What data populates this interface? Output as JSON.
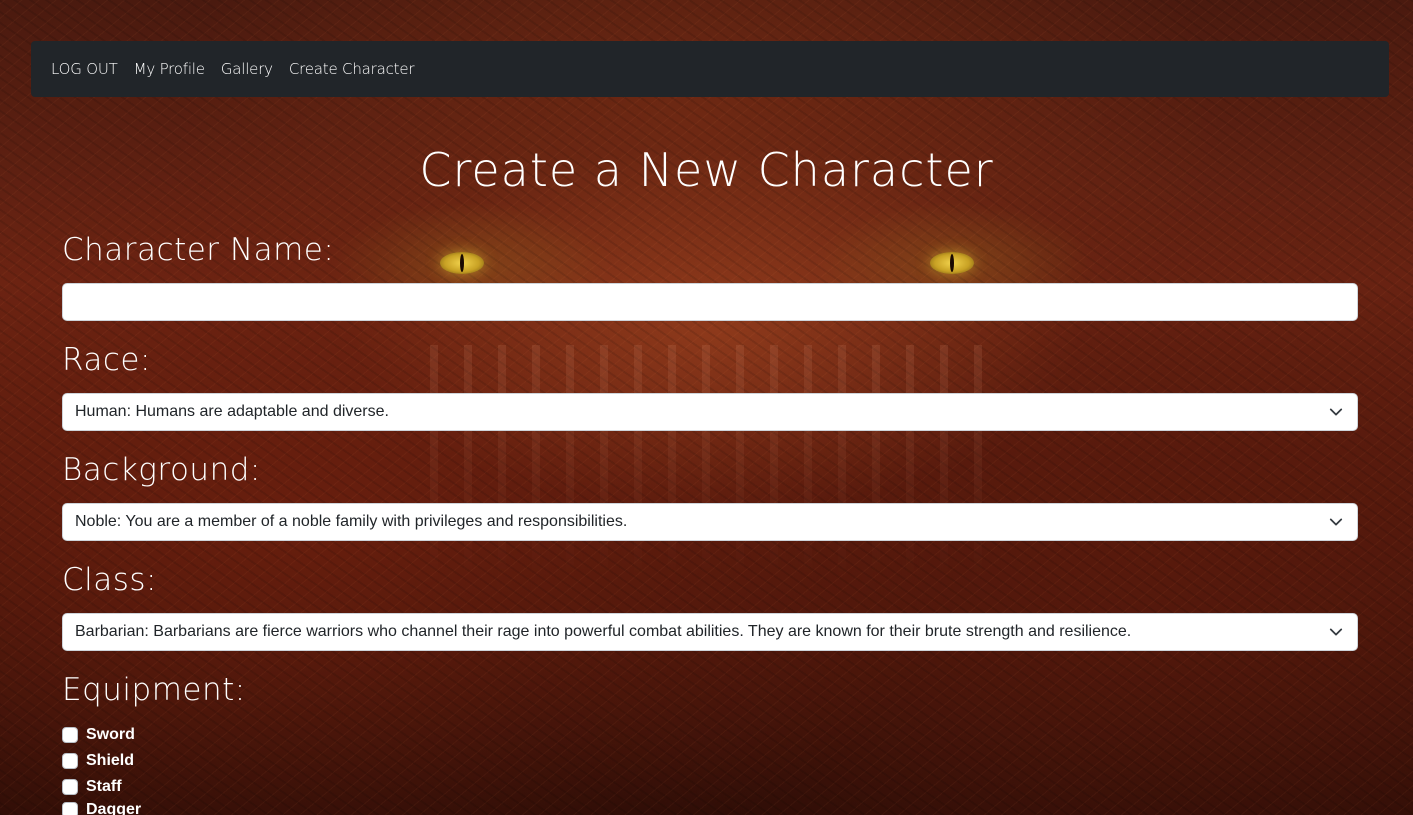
{
  "nav": {
    "logout": "LOG OUT",
    "profile": "My Profile",
    "gallery": "Gallery",
    "create": "Create Character"
  },
  "page": {
    "title": "Create a New Character"
  },
  "form": {
    "name_label": "Character Name:",
    "name_value": "",
    "race_label": "Race:",
    "race_value": "Human: Humans are adaptable and diverse.",
    "background_label": "Background:",
    "background_value": "Noble: You are a member of a noble family with privileges and responsibilities.",
    "class_label": "Class:",
    "class_value": "Barbarian: Barbarians are fierce warriors who channel their rage into powerful combat abilities. They are known for their brute strength and resilience.",
    "equipment_label": "Equipment:",
    "equipment": [
      {
        "label": "Sword",
        "checked": false
      },
      {
        "label": "Shield",
        "checked": false
      },
      {
        "label": "Staff",
        "checked": false
      },
      {
        "label": "Dagger",
        "checked": false
      }
    ]
  },
  "icons": {
    "select": "chevron-down-icon"
  },
  "colors": {
    "navbar": "#212529",
    "input_bg": "#ffffff",
    "text": "#ffffff"
  }
}
